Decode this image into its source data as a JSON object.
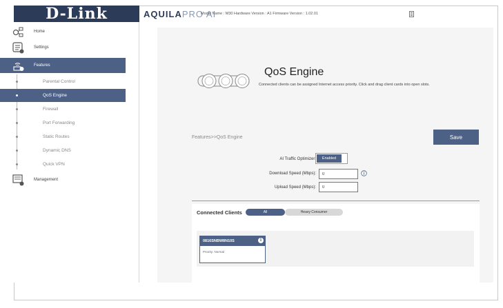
{
  "header": {
    "logo": "D-Link",
    "brand_main": "AQUILA",
    "brand_pro": "PRO AI",
    "model_info": "Model Name : M30 Hardware Version : A1 Firmware Version : 1.02.01"
  },
  "sidebar": {
    "home": "Home",
    "settings": "Settings",
    "features": "Features",
    "sub_items": [
      "Parental Control",
      "QoS Engine",
      "Firewall",
      "Port Forwarding",
      "Static Routes",
      "Dynamic DNS",
      "Quick VPN"
    ],
    "management": "Management"
  },
  "page": {
    "title": "QoS Engine",
    "subtitle": "Connected clients can be assigned Internet access priority. Click and drag client cards into open slots.",
    "breadcrumb": "Features>>QoS Engine",
    "save_label": "Save"
  },
  "form": {
    "ai_optimizer_label": "AI Traffic Optimizer:",
    "ai_optimizer_state": "Enabled",
    "download_label": "Download Speed (Mbps):",
    "download_value": "0",
    "upload_label": "Upload Speed (Mbps):",
    "upload_value": "0"
  },
  "clients": {
    "title": "Connected Clients",
    "tab_all": "All",
    "tab_heavy": "Heavy Consumer",
    "cards": [
      {
        "name": "0816SNBW8N10S",
        "priority": "Priority: Normal"
      }
    ]
  },
  "colors": {
    "accent": "#4d6187",
    "logo_bg": "#2c3b57"
  }
}
